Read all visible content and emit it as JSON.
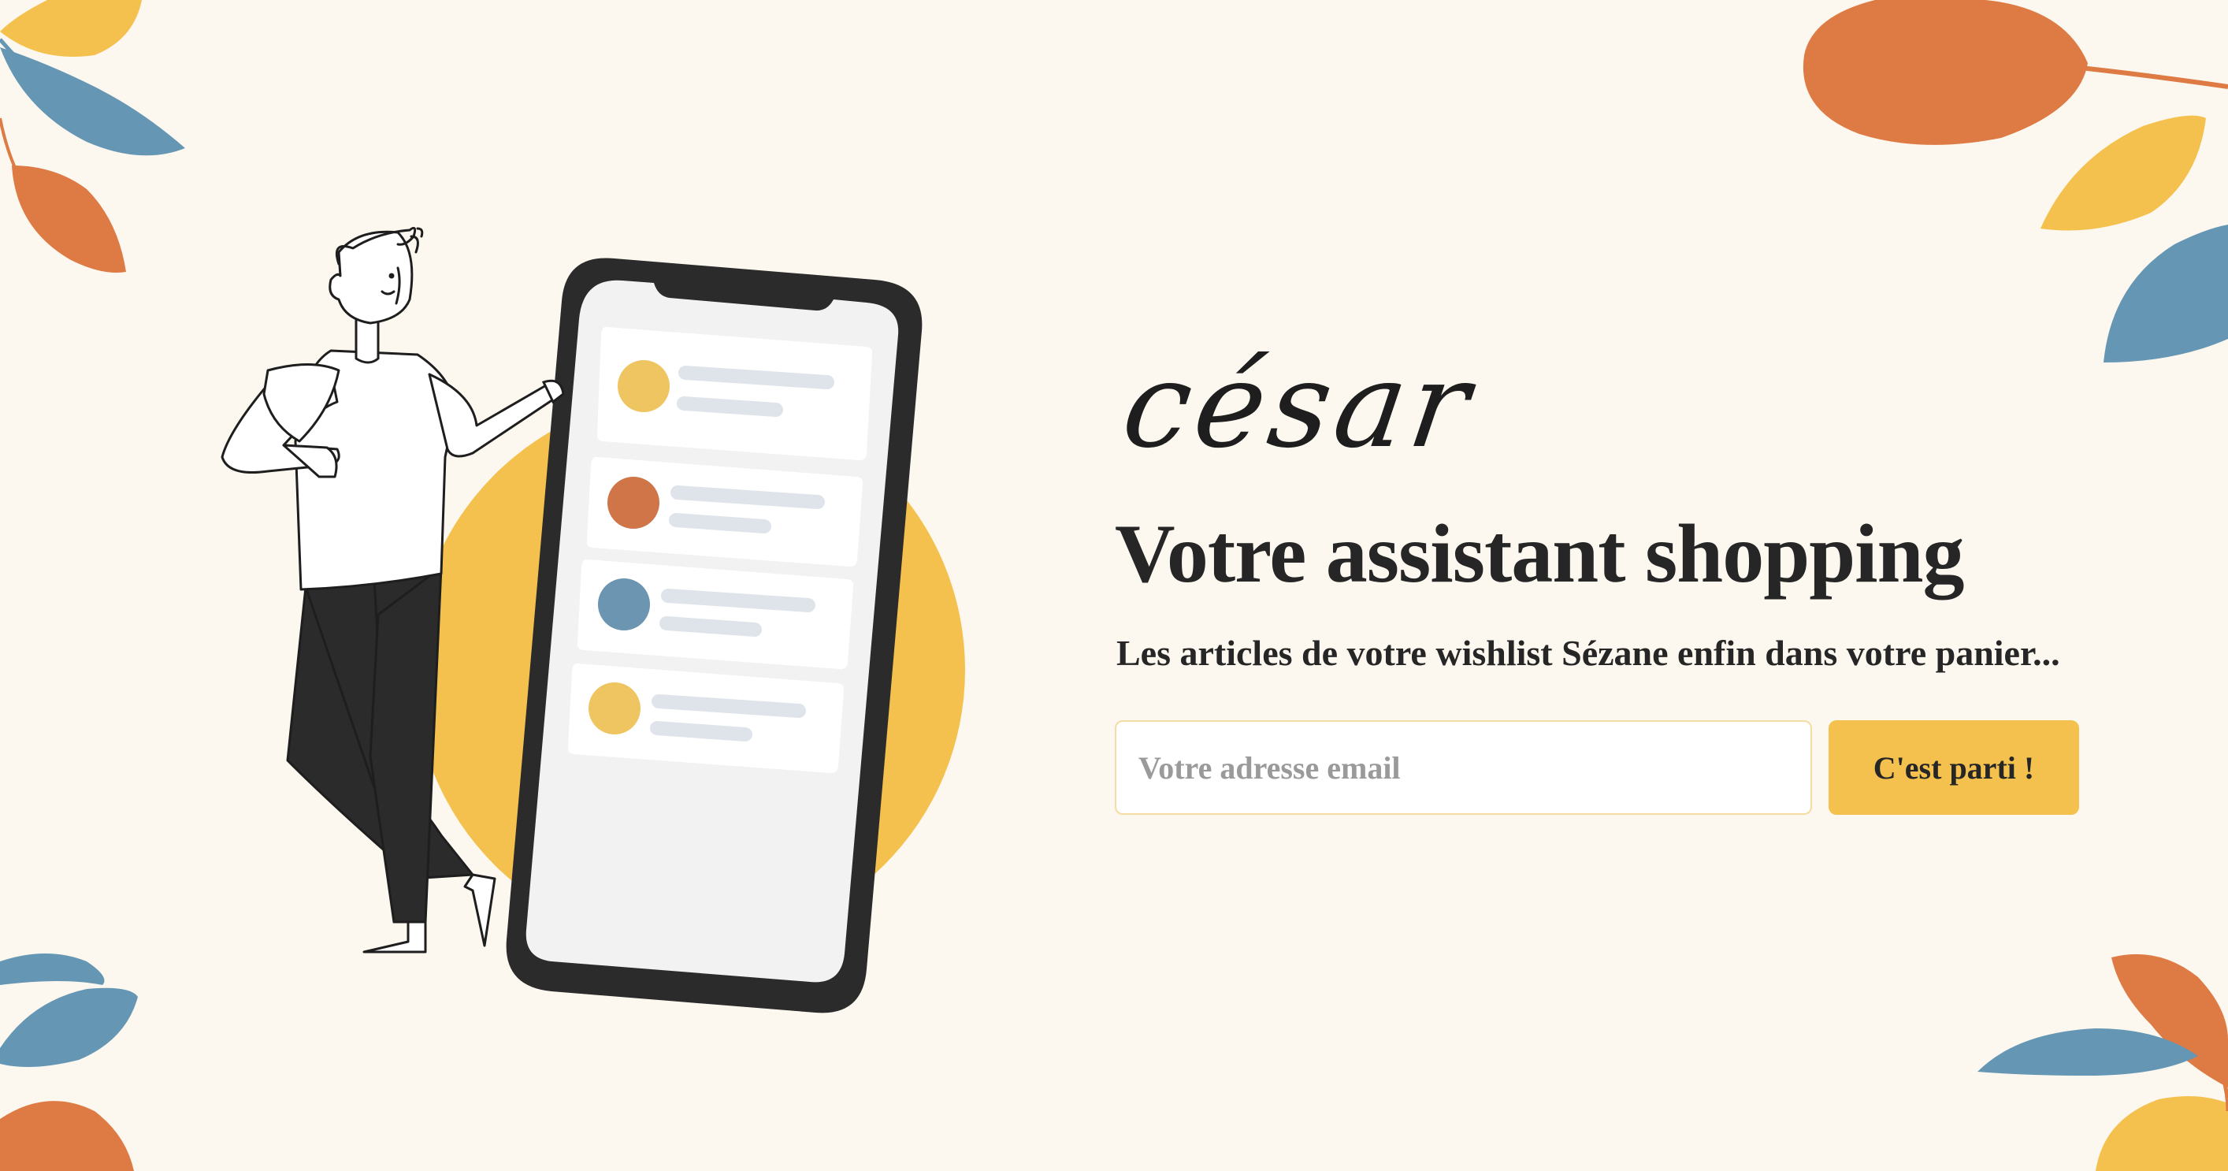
{
  "brand": {
    "logo_text": "césar"
  },
  "hero": {
    "headline": "Votre assistant shopping",
    "subtitle": "Les articles de votre wishlist Sézane enfin dans votre panier..."
  },
  "signup_form": {
    "email_placeholder": "Votre adresse email",
    "email_value": "",
    "submit_label": "C'est parti !"
  },
  "illustration": {
    "phone_list_items": [
      {
        "dot_color": "#efc562"
      },
      {
        "dot_color": "#cf7547"
      },
      {
        "dot_color": "#6b95b0"
      },
      {
        "dot_color": "#efc562"
      }
    ]
  },
  "colors": {
    "background": "#fdf8ef",
    "accent_yellow": "#f4c14e",
    "leaf_orange": "#de7a43",
    "leaf_blue": "#6596b4",
    "leaf_yellow": "#f4c14e",
    "text": "#262626"
  }
}
